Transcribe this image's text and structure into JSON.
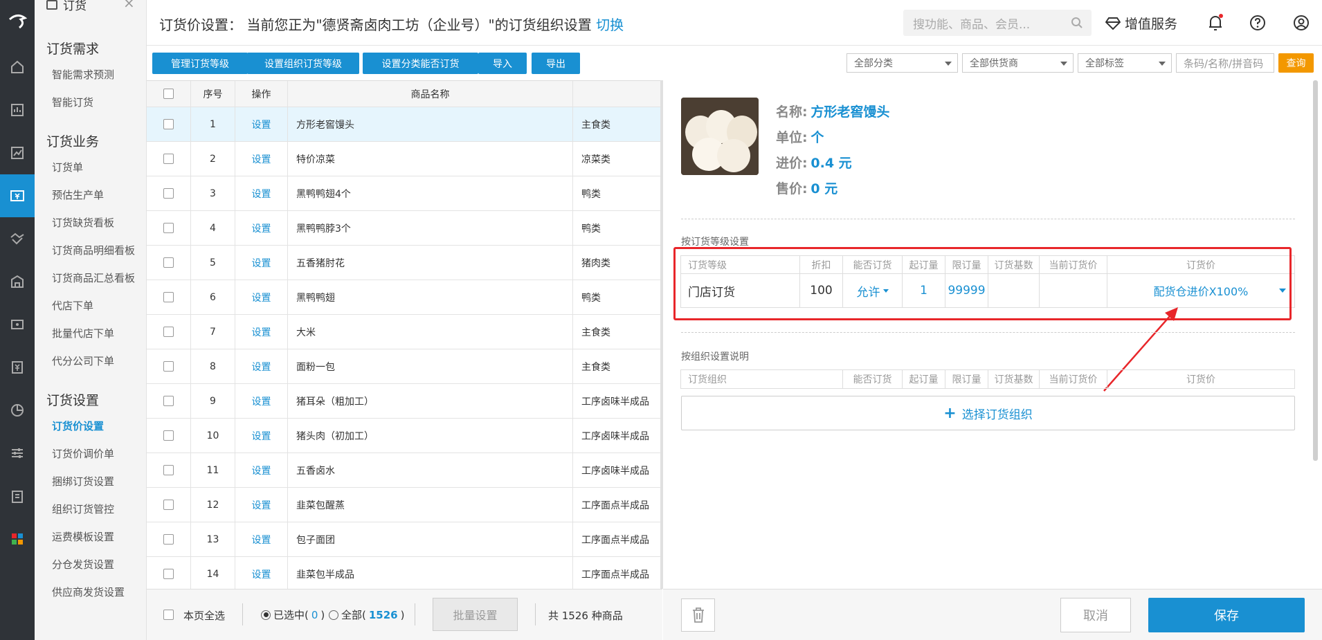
{
  "sidebar": {
    "module_title": "订货",
    "groups": [
      {
        "title": "订货需求",
        "items": [
          "智能需求预测",
          "智能订货"
        ]
      },
      {
        "title": "订货业务",
        "items": [
          "订货单",
          "预估生产单",
          "订货缺货看板",
          "订货商品明细看板",
          "订货商品汇总看板",
          "代店下单",
          "批量代店下单",
          "代分公司下单"
        ]
      },
      {
        "title": "订货设置",
        "items": [
          "订货价设置",
          "订货价调价单",
          "捆绑订货设置",
          "组织订货管控",
          "运费模板设置",
          "分仓发货设置",
          "供应商发货设置"
        ]
      }
    ],
    "active": "订货价设置"
  },
  "header": {
    "title_prefix": "订货价设置：  当前您正为\"德贤斋卤肉工坊（企业号）\"的订货组织设置",
    "switch_label": "切换",
    "search_placeholder": "搜功能、商品、会员...",
    "vip_label": "增值服务"
  },
  "toolbar": {
    "buttons": [
      "管理订货等级",
      "设置组织订货等级",
      "设置分类能否订货",
      "导入",
      "导出"
    ],
    "filters": [
      "全部分类",
      "全部供货商",
      "全部标签"
    ],
    "search_placeholder": "条码/名称/拼音码",
    "query_label": "查询"
  },
  "table": {
    "headers": [
      "序号",
      "操作",
      "商品名称"
    ],
    "rows": [
      {
        "no": "1",
        "op": "设置",
        "name": "方形老窖馒头",
        "cat": "主食类"
      },
      {
        "no": "2",
        "op": "设置",
        "name": "特价凉菜",
        "cat": "凉菜类"
      },
      {
        "no": "3",
        "op": "设置",
        "name": "黑鸭鸭翅4个",
        "cat": "鸭类"
      },
      {
        "no": "4",
        "op": "设置",
        "name": "黑鸭鸭脖3个",
        "cat": "鸭类"
      },
      {
        "no": "5",
        "op": "设置",
        "name": "五香猪肘花",
        "cat": "猪肉类"
      },
      {
        "no": "6",
        "op": "设置",
        "name": "黑鸭鸭翅",
        "cat": "鸭类"
      },
      {
        "no": "7",
        "op": "设置",
        "name": "大米",
        "cat": "主食类"
      },
      {
        "no": "8",
        "op": "设置",
        "name": "面粉一包",
        "cat": "主食类"
      },
      {
        "no": "9",
        "op": "设置",
        "name": "猪耳朵（粗加工）",
        "cat": "工序卤味半成品"
      },
      {
        "no": "10",
        "op": "设置",
        "name": "猪头肉（初加工）",
        "cat": "工序卤味半成品"
      },
      {
        "no": "11",
        "op": "设置",
        "name": "五香卤水",
        "cat": "工序卤味半成品"
      },
      {
        "no": "12",
        "op": "设置",
        "name": "韭菜包醒蒸",
        "cat": "工序面点半成品"
      },
      {
        "no": "13",
        "op": "设置",
        "name": "包子面团",
        "cat": "工序面点半成品"
      },
      {
        "no": "14",
        "op": "设置",
        "name": "韭菜包半成品",
        "cat": "工序面点半成品"
      }
    ]
  },
  "footer": {
    "select_page": "本页全选",
    "selected": "已选中(",
    "selected_count": "0",
    "all": "全部(",
    "all_count": "1526",
    "close_paren": ")",
    "batch": "批量设置",
    "total": "共 1526 种商品"
  },
  "detail": {
    "name_label": "名称:",
    "name": "方形老窖馒头",
    "unit_label": "单位:",
    "unit": "个",
    "cost_label": "进价:",
    "cost": "0.4 元",
    "sale_label": "售价:",
    "sale": "0 元",
    "level_section": "按订货等级设置",
    "level_headers": [
      "订货等级",
      "折扣",
      "能否订货",
      "起订量",
      "限订量",
      "订货基数",
      "当前订货价",
      "订货价"
    ],
    "level_row": {
      "level": "门店订货",
      "discount": "100",
      "allow": "允许",
      "min": "1",
      "max": "99999",
      "base": "",
      "current": "",
      "price": "配货仓进价X100%"
    },
    "org_section": "按组织设置说明",
    "org_headers": [
      "订货组织",
      "能否订货",
      "起订量",
      "限订量",
      "订货基数",
      "当前订货价",
      "订货价"
    ],
    "choose_org": "选择订货组织",
    "cancel": "取消",
    "save": "保存"
  },
  "colors": {
    "accent": "#1990d2",
    "highlight": "#e8262a",
    "query": "#f39800"
  }
}
